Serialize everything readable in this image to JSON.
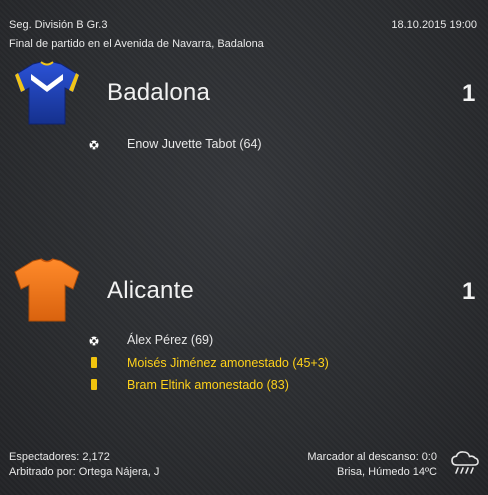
{
  "header": {
    "competition": "Seg. División B Gr.3",
    "datetime": "18.10.2015 19:00",
    "venue_line": "Final de partido en el Avenida de Navarra, Badalona"
  },
  "home": {
    "name": "Badalona",
    "score": "1",
    "kit_colors": {
      "body": "#1d3fb5",
      "trim": "#f0c419",
      "chevron": "#ffffff"
    },
    "kit_icon": "shirt-icon",
    "events": [
      {
        "type": "goal",
        "icon": "ball-icon",
        "text": "Enow Juvette Tabot (64)"
      }
    ]
  },
  "away": {
    "name": "Alicante",
    "score": "1",
    "kit_colors": {
      "body": "#f07a1c"
    },
    "kit_icon": "shirt-icon",
    "events": [
      {
        "type": "goal",
        "icon": "ball-icon",
        "text": "Álex Pérez (69)"
      },
      {
        "type": "card",
        "icon": "yellow-card-icon",
        "text": "Moisés Jiménez amonestado (45+3)"
      },
      {
        "type": "card",
        "icon": "yellow-card-icon",
        "text": "Bram Eltink amonestado (83)"
      }
    ]
  },
  "footer": {
    "attendance": "Espectadores: 2,172",
    "referee": "Arbitrado por: Ortega Nájera, J",
    "halftime": "Marcador al descanso: 0:0",
    "weather_text": "Brisa, Húmedo 14ºC",
    "weather_icon": "rain-cloud-icon"
  },
  "colors": {
    "card_text": "#ffd21a",
    "background": "#2a2c2f"
  }
}
